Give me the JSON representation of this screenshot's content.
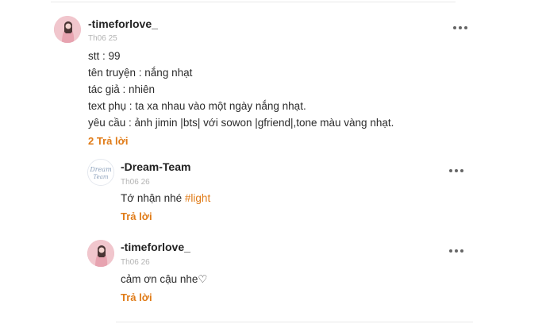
{
  "comments": [
    {
      "username": "-timeforlove_",
      "time": "Th06 25",
      "avatar_icon": "user-avatar-photo",
      "lines": [
        "stt : 99",
        "tên truyện : nắng nhạt",
        "tác giả : nhiên",
        "text phụ : ta xa nhau vào một ngày nắng nhạt.",
        "yêu cầu : ảnh jimin |bts| với sowon |gfriend|,tone màu vàng nhạt."
      ],
      "replies_label": "2 Trả lời"
    }
  ],
  "replies": [
    {
      "username": "-Dream-Team",
      "time": "Th06 26",
      "avatar_icon": "dream-team-logo",
      "avatar_logo_text": "Dream Team",
      "text": "Tớ nhận nhé ",
      "hashtag": "#light",
      "reply_label": "Trả lời"
    },
    {
      "username": "-timeforlove_",
      "time": "Th06 26",
      "avatar_icon": "user-avatar-photo",
      "text": "cảm ơn cậu nhe♡",
      "reply_label": "Trả lời"
    }
  ],
  "colors": {
    "accent": "#e07b17",
    "timestamp": "#b3b3b3",
    "text": "#2b2b2b"
  }
}
